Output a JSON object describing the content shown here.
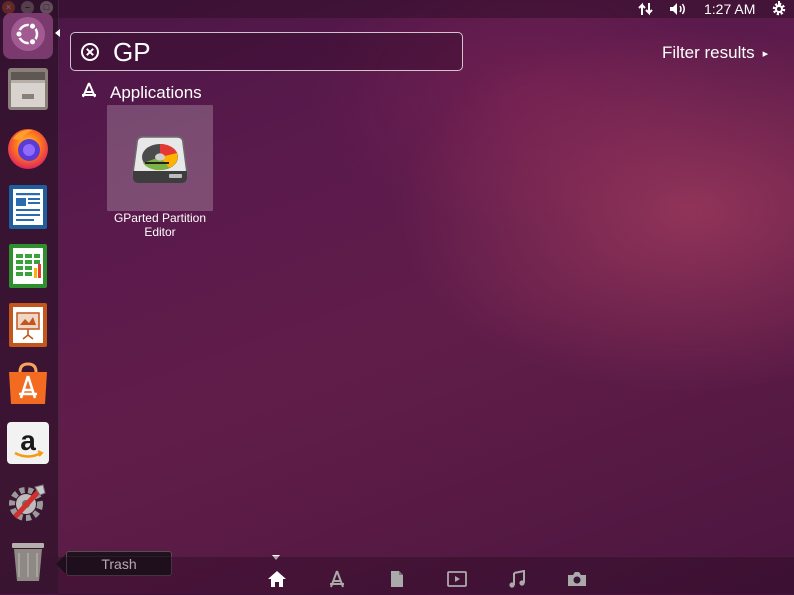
{
  "window": {
    "close_symbol": "×",
    "minimize_symbol": "–",
    "maximize_symbol": "□"
  },
  "top_panel": {
    "clock": "1:27 AM",
    "indicators": [
      "network-updown-icon",
      "volume-icon",
      "session-gear-icon"
    ]
  },
  "launcher": {
    "items": [
      {
        "name": "Dash Home",
        "icon": "ubuntu-logo-icon"
      },
      {
        "name": "Files",
        "icon": "file-cabinet-icon"
      },
      {
        "name": "Firefox",
        "icon": "firefox-icon"
      },
      {
        "name": "LibreOffice Writer",
        "icon": "writer-icon"
      },
      {
        "name": "LibreOffice Calc",
        "icon": "calc-icon"
      },
      {
        "name": "LibreOffice Impress",
        "icon": "impress-icon"
      },
      {
        "name": "Ubuntu Software Center",
        "icon": "software-center-icon"
      },
      {
        "name": "Amazon",
        "icon": "amazon-icon"
      },
      {
        "name": "System Settings",
        "icon": "settings-icon"
      },
      {
        "name": "Trash",
        "icon": "trash-icon"
      }
    ],
    "tooltip": "Trash"
  },
  "search": {
    "value": "GP",
    "clear_icon": "clear-icon"
  },
  "filter": {
    "label": "Filter results",
    "arrow": "▸"
  },
  "results": {
    "category": "Applications",
    "apps": [
      {
        "label": "GParted Partition Editor",
        "icon": "gparted-disk-icon"
      }
    ]
  },
  "lens_bar": {
    "active": "home",
    "lenses": [
      "home-lens-icon",
      "apps-lens-icon",
      "files-lens-icon",
      "video-lens-icon",
      "music-lens-icon",
      "photo-lens-icon"
    ]
  },
  "colors": {
    "accent_orange": "#f15d22",
    "tile_highlight": "rgba(255,255,255,0.22)"
  }
}
